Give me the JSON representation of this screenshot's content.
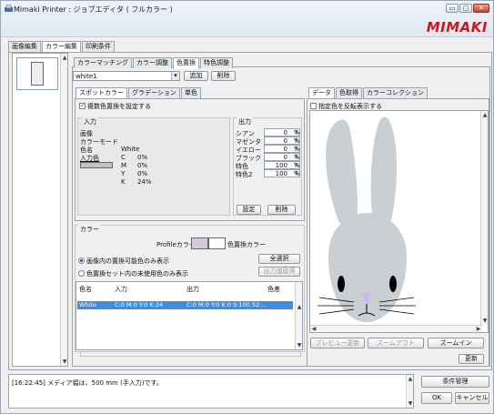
{
  "window": {
    "title": "Mimaki Printer : ジョブエディタ ( フルカラー )",
    "brand": "MIMAKI",
    "min_glyph": "▭",
    "max_glyph": "▢",
    "close_glyph": "✕"
  },
  "main_tabs": [
    "画像編集",
    "カラー編集",
    "印刷条件"
  ],
  "sub_tabs": [
    "カラーマッチング",
    "カラー調整",
    "色置換",
    "特色調整"
  ],
  "color_select": {
    "value": "white1",
    "arrow": "▾"
  },
  "toolbar": {
    "add_label": "追加",
    "delete_label": "削除"
  },
  "color_tabs": [
    "スポットカラー",
    "グラデーション",
    "単色"
  ],
  "multi_replace": {
    "label": "複数色置換を設定する",
    "checked": true
  },
  "input_group": {
    "title": "入力",
    "rows": [
      {
        "label": "画像",
        "value": ""
      },
      {
        "label": "カラーモード",
        "value": ""
      },
      {
        "label": "色名",
        "value": "White"
      },
      {
        "label": "入力色",
        "value": ""
      }
    ],
    "cmyk": [
      {
        "ch": "C",
        "val": "0%"
      },
      {
        "ch": "M",
        "val": "0%"
      },
      {
        "ch": "Y",
        "val": "0%"
      },
      {
        "ch": "K",
        "val": "24%"
      }
    ]
  },
  "output_group": {
    "title": "出力",
    "fields": [
      {
        "label": "シアン",
        "value": "0",
        "unit": "%"
      },
      {
        "label": "マゼンタ",
        "value": "0",
        "unit": "%"
      },
      {
        "label": "イエロー",
        "value": "0",
        "unit": "%"
      },
      {
        "label": "ブラック",
        "value": "0",
        "unit": "%"
      },
      {
        "label": "特色",
        "value": "100",
        "unit": "%"
      },
      {
        "label": "特色2",
        "value": "100",
        "unit": "%"
      }
    ],
    "set_label": "設定",
    "delete_label": "削除"
  },
  "color_section": {
    "title": "カラー",
    "profile_label": "Profileカラー",
    "replace_label": "色置換カラー",
    "radio1": "画像内の置換可能色のみ表示",
    "radio2": "色置換セット内の未使用色のみ表示",
    "select_all": "全選択",
    "output_acquire": "出力値取得"
  },
  "table": {
    "headers": [
      "色名",
      "入力",
      "出力",
      "色差"
    ],
    "rows": [
      {
        "name": "White",
        "input": "C:0 M:0 Y:0 K:24",
        "output": "C:0 M:0 Y:0 K:0 S:100 S2:..."
      }
    ]
  },
  "right_tabs": [
    "データ",
    "色取得",
    "カラーコレクション"
  ],
  "invert": {
    "label": "指定色を反転表示する",
    "checked": false
  },
  "preview_buttons": [
    "プレビュー更新",
    "ズームアウト",
    "ズームイン"
  ],
  "refresh_label": "更新",
  "log": {
    "text": "[16:22:45] メディア幅は、500 mm (手入力)です。"
  },
  "bottom_buttons": {
    "conditions": "条件管理",
    "ok": "OK",
    "cancel": "キャンセル"
  },
  "colors": {
    "accent_selection": "#3d8ee0",
    "profile_swatch": "#d8c8dc",
    "brand_red": "#c8171e"
  }
}
